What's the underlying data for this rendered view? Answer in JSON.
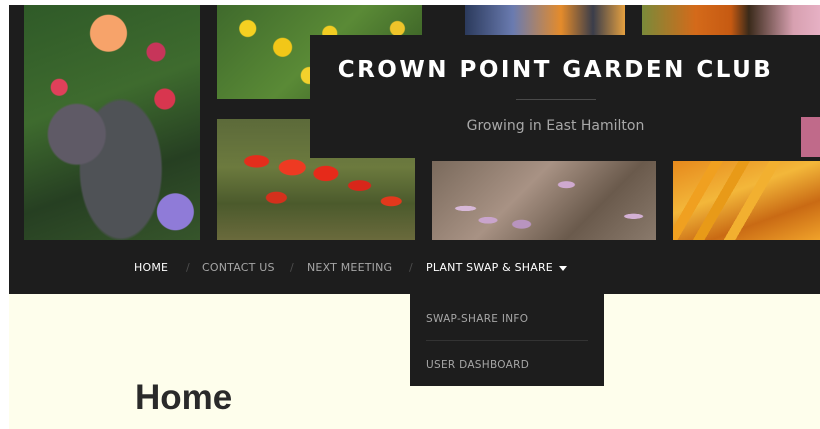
{
  "site": {
    "title": "CROWN POINT GARDEN CLUB",
    "tagline": "Growing in East Hamilton"
  },
  "nav": {
    "items": [
      {
        "label": "HOME"
      },
      {
        "label": "CONTACT US"
      },
      {
        "label": "NEXT MEETING"
      },
      {
        "label": "PLANT SWAP & SHARE"
      }
    ],
    "separator": "/"
  },
  "dropdown": {
    "items": [
      {
        "label": "SWAP-SHARE INFO"
      },
      {
        "label": "USER DASHBOARD"
      }
    ]
  },
  "page": {
    "title": "Home"
  },
  "icons": {
    "dropdown_caret": "chevron-down-icon"
  },
  "colors": {
    "header_bg": "#1d1d1d",
    "page_bg": "#fefeec",
    "nav_text": "#a6a6a6",
    "nav_active": "#ffffff"
  }
}
